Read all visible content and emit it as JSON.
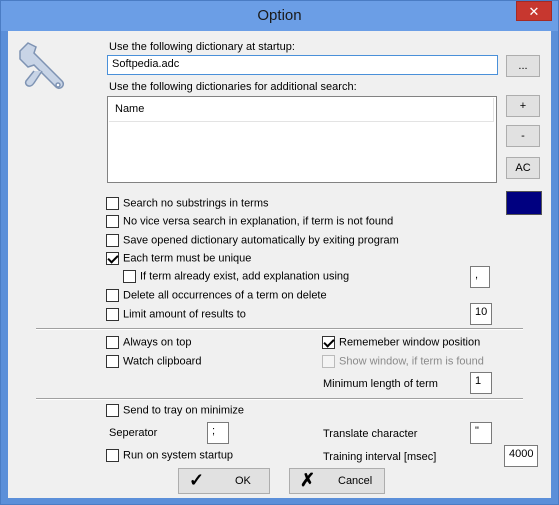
{
  "window": {
    "title": "Option",
    "close_glyph": "✕"
  },
  "dictionary": {
    "startup_label": "Use the following dictionary at startup:",
    "startup_value": "Softpedia.adc",
    "browse_label": "...",
    "additional_label": "Use the following dictionaries for additional search:",
    "list_column": "Name",
    "add_label": "+",
    "remove_label": "-",
    "ac_label": "AC",
    "color": "#000080"
  },
  "options": {
    "search_substrings": "Search no substrings in terms",
    "no_vice_versa": "No vice versa search in explanation, if term is not found",
    "save_opened": "Save opened dictionary automatically by exiting program",
    "term_unique": "Each term must be unique",
    "term_exists": "If term already exist, add explanation using",
    "term_exists_value": ",",
    "delete_all": "Delete all occurrences of a term on delete",
    "limit_results": "Limit amount of results to",
    "limit_value": "10"
  },
  "window_options": {
    "always_on_top": "Always on top",
    "watch_clipboard": "Watch clipboard",
    "remember_position": "Rememeber window position",
    "show_window": "Show window, if term is found",
    "min_length_label": "Minimum length of term",
    "min_length_value": "1"
  },
  "tray_options": {
    "send_to_tray": "Send to tray on minimize",
    "separator_label": "Seperator",
    "separator_value": ";",
    "translate_label": "Translate character",
    "translate_value": "\"",
    "run_startup": "Run on system startup",
    "training_label": "Training interval [msec]",
    "training_value": "4000"
  },
  "buttons": {
    "ok_label": "OK",
    "cancel_label": "Cancel"
  },
  "icons": {
    "settings": "wrench-icon",
    "ok": "checkmark-icon",
    "cancel": "x-icon"
  }
}
